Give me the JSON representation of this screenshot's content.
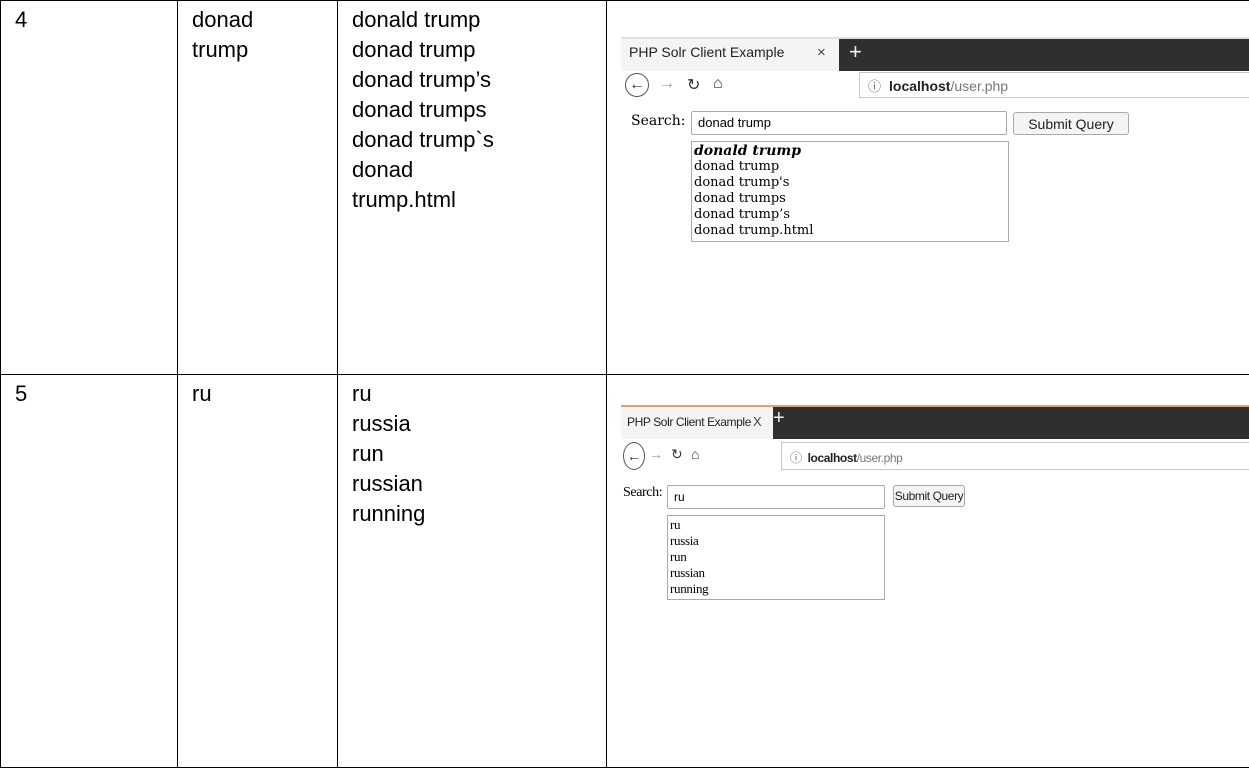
{
  "rows": [
    {
      "number": "4",
      "query_lines": [
        "donad",
        "trump"
      ],
      "suggestions": [
        "donald trump",
        "donad trump",
        "donad trump’s",
        "donad trumps",
        "donad trump`s",
        "donad",
        "trump.html"
      ],
      "browser": {
        "tab_title": "PHP Solr Client Example",
        "tab_close": "×",
        "new_tab": "+",
        "url_host": "localhost",
        "url_path": "/user.php",
        "search_label": "Search:",
        "search_value": "donad trump",
        "submit_label": "Submit Query",
        "dropdown_items": [
          "donald trump",
          "donad trump",
          "donad trump's",
          "donad trumps",
          "donad trump’s",
          "donad trump.html"
        ]
      }
    },
    {
      "number": "5",
      "query_lines": [
        "ru"
      ],
      "suggestions": [
        "ru",
        "russia",
        "run",
        "russian",
        "running"
      ],
      "browser": {
        "tab_title": "PHP Solr Client Example",
        "tab_close": "X",
        "new_tab": "+",
        "url_host": "localhost",
        "url_path": "/user.php",
        "search_label": "Search:",
        "search_value": "ru",
        "submit_label": "Submit Query",
        "dropdown_items": [
          "ru",
          "russia",
          "run",
          "russian",
          "running"
        ]
      }
    }
  ]
}
